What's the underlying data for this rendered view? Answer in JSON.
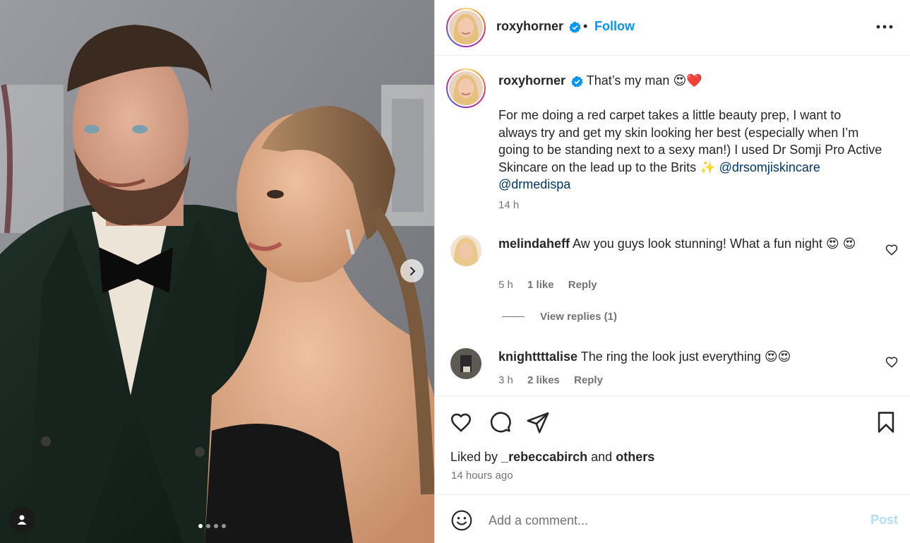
{
  "photo": {
    "carousel_dots": 4,
    "active_dot": 0,
    "next_icon": "chevron-right-icon",
    "tag_icon": "user-tag-icon"
  },
  "header": {
    "username": "roxyhorner",
    "separator": "•",
    "follow_label": "Follow",
    "more_icon": "more-horizontal-icon"
  },
  "caption": {
    "username": "roxyhorner",
    "headline": "That’s my man 😍❤️",
    "body": "For me doing a red carpet takes a little beauty prep, I want to always try and get my skin looking her best (especially when I’m going to be standing next to a sexy man!) I used Dr Somji Pro Active Skincare on the lead up to the Brits ✨",
    "mention_1": "@drsomjiskincare",
    "mention_2": "@drmedispa",
    "time": "14 h"
  },
  "comments": [
    {
      "username": "melindaheff",
      "text": "Aw you guys look stunning! What a fun night 😍 😍",
      "time": "5 h",
      "likes": "1 like",
      "reply": "Reply",
      "view_replies": "View replies (1)"
    },
    {
      "username": "knighttttalise",
      "text": "The ring the look just everything 😍😍",
      "time": "3 h",
      "likes": "2 likes",
      "reply": "Reply"
    }
  ],
  "actions": {
    "like_icon": "heart-icon",
    "comment_icon": "comment-icon",
    "share_icon": "share-icon",
    "save_icon": "bookmark-icon",
    "liked_by_prefix": "Liked by",
    "liked_by_user": "_rebeccabirch",
    "liked_by_and": "and",
    "liked_by_others": "others",
    "posted_ago": "14 hours ago"
  },
  "composer": {
    "placeholder": "Add a comment...",
    "post_label": "Post",
    "emoji_icon": "emoji-icon"
  },
  "colors": {
    "link_blue": "#0095f6",
    "mention_blue": "#00376b",
    "muted_text": "#737373",
    "post_disabled": "#b2dffc",
    "verified_blue": "#0095f6"
  }
}
